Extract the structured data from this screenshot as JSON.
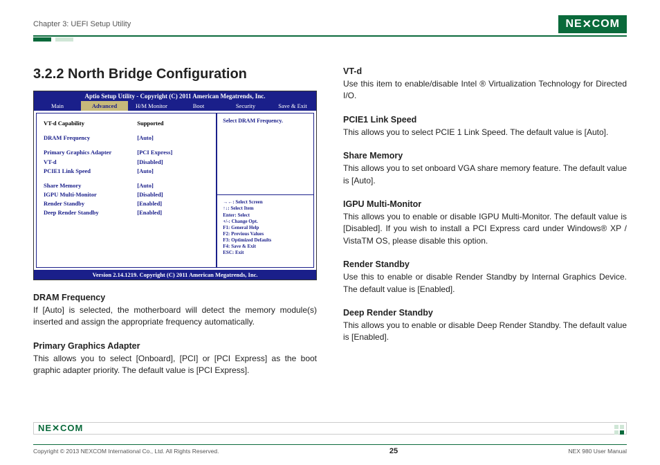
{
  "header": {
    "chapter": "Chapter 3: UEFI Setup Utility",
    "brand": "NE COM",
    "brand_x": "X"
  },
  "section": {
    "number_title": "3.2.2  North Bridge Configuration"
  },
  "bios": {
    "titlebar": "Aptio Setup Utility - Copyright (C) 2011 American Megatrends, Inc.",
    "tabs": [
      "Main",
      "Advanced",
      "H/M Monitor",
      "Boot",
      "Security",
      "Save & Exit"
    ],
    "active_tab_index": 1,
    "rows": [
      {
        "label": "VT-d Capability",
        "value": "Supported",
        "black": true
      },
      {
        "gap": true
      },
      {
        "label": "DRAM Frequency",
        "value": "[Auto]"
      },
      {
        "gap": true
      },
      {
        "label": "Primary Graphics Adapter",
        "value": "[PCI Express]"
      },
      {
        "label": "VT-d",
        "value": "[Disabled]"
      },
      {
        "label": "PCIE1 Link Speed",
        "value": "[Auto]"
      },
      {
        "gap": true
      },
      {
        "label": "Share Memory",
        "value": "[Auto]"
      },
      {
        "label": "IGPU Multi-Monitor",
        "value": "[Disabled]"
      },
      {
        "label": "Render Standby",
        "value": "[Enabled]"
      },
      {
        "label": "Deep Render Standby",
        "value": "[Enabled]"
      }
    ],
    "hint": "Select DRAM Frequency.",
    "help_lines": [
      "→←: Select Screen",
      "↑↓: Select Item",
      "Enter: Select",
      "+/-: Change Opt.",
      "F1: General Help",
      "F2: Previous Values",
      "F3: Optimized Defaults",
      "F4: Save & Exit",
      "ESC: Exit"
    ],
    "footer": "Version 2.14.1219. Copyright (C) 2011 American Megatrends, Inc."
  },
  "left_descs": [
    {
      "title": "DRAM Frequency",
      "body": "If [Auto] is selected, the motherboard will detect the memory module(s) inserted and assign the appropriate frequency automatically."
    },
    {
      "title": "Primary Graphics Adapter",
      "body": "This allows you to select [Onboard], [PCI] or [PCI Express] as the boot graphic adapter priority. The default value is [PCI Express]."
    }
  ],
  "right_descs": [
    {
      "title": "VT-d",
      "body": "Use this item to enable/disable Intel ® Virtualization Technology for Directed I/O."
    },
    {
      "title": "PCIE1 Link Speed",
      "body": "This allows you to select PCIE 1 Link Speed. The default value is [Auto]."
    },
    {
      "title": "Share Memory",
      "body": "This allows you to set onboard VGA share memory feature. The default value is [Auto]."
    },
    {
      "title": "IGPU Multi-Monitor",
      "body": "This allows you to enable or disable IGPU Multi-Monitor. The default value is [Disabled]. If you wish to install a PCI Express card under Windows® XP / VistaTM OS, please disable this option."
    },
    {
      "title": "Render Standby",
      "body": "Use this to enable or disable Render Standby by Internal Graphics Device. The default value is [Enabled]."
    },
    {
      "title": "Deep Render Standby",
      "body": "This allows you to enable or disable Deep Render Standby. The default  value is [Enabled]."
    }
  ],
  "footer": {
    "copyright": "Copyright © 2013 NEXCOM International Co., Ltd. All Rights Reserved.",
    "page": "25",
    "manual": "NEX 980 User Manual",
    "brand": "NE COM",
    "brand_x": "X"
  }
}
